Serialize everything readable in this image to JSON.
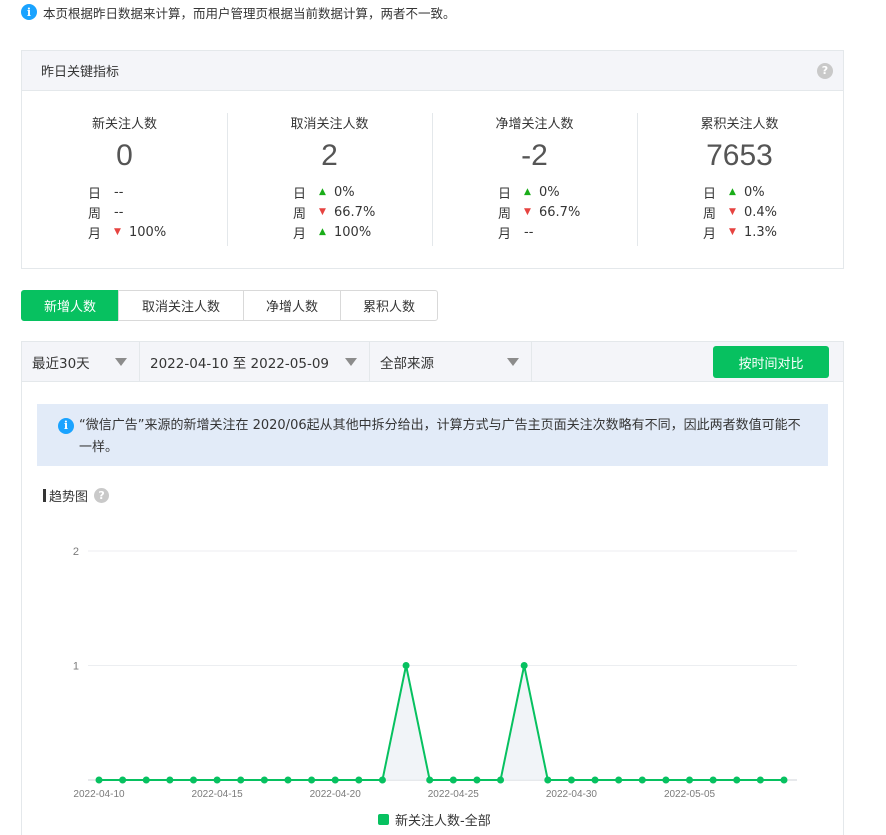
{
  "notice": "本页根据昨日数据来计算，而用户管理页根据当前数据计算，两者不一致。",
  "card": {
    "title": "昨日关键指标",
    "metrics": [
      {
        "title": "新关注人数",
        "value": "0",
        "rows": [
          {
            "label": "日",
            "dir": "",
            "text": "--"
          },
          {
            "label": "周",
            "dir": "",
            "text": "--"
          },
          {
            "label": "月",
            "dir": "down",
            "text": "100%"
          }
        ]
      },
      {
        "title": "取消关注人数",
        "value": "2",
        "rows": [
          {
            "label": "日",
            "dir": "up",
            "text": "0%"
          },
          {
            "label": "周",
            "dir": "down",
            "text": "66.7%"
          },
          {
            "label": "月",
            "dir": "up",
            "text": "100%"
          }
        ]
      },
      {
        "title": "净增关注人数",
        "value": "-2",
        "rows": [
          {
            "label": "日",
            "dir": "up",
            "text": "0%"
          },
          {
            "label": "周",
            "dir": "down",
            "text": "66.7%"
          },
          {
            "label": "月",
            "dir": "",
            "text": "--"
          }
        ]
      },
      {
        "title": "累积关注人数",
        "value": "7653",
        "rows": [
          {
            "label": "日",
            "dir": "up",
            "text": "0%"
          },
          {
            "label": "周",
            "dir": "down",
            "text": "0.4%"
          },
          {
            "label": "月",
            "dir": "down",
            "text": "1.3%"
          }
        ]
      }
    ]
  },
  "tabs": [
    {
      "label": "新增人数",
      "active": true
    },
    {
      "label": "取消关注人数",
      "active": false
    },
    {
      "label": "净增人数",
      "active": false
    },
    {
      "label": "累积人数",
      "active": false
    }
  ],
  "filters": {
    "range": "最近30天",
    "dates": "2022-04-10 至 2022-05-09",
    "source": "全部来源",
    "compare_button": "按时间对比"
  },
  "tip": "“微信广告”来源的新增关注在 2020/06起从其他中拆分给出，计算方式与广告主页面关注次数略有不同，因此两者数值可能不一样。",
  "trend_title": "趋势图",
  "colors": {
    "accent": "#07c160",
    "up": "#1aad19",
    "down": "#e64340",
    "info": "#1aa3ff"
  },
  "chart_data": {
    "type": "line",
    "x": [
      "2022-04-10",
      "2022-04-11",
      "2022-04-12",
      "2022-04-13",
      "2022-04-14",
      "2022-04-15",
      "2022-04-16",
      "2022-04-17",
      "2022-04-18",
      "2022-04-19",
      "2022-04-20",
      "2022-04-21",
      "2022-04-22",
      "2022-04-23",
      "2022-04-24",
      "2022-04-25",
      "2022-04-26",
      "2022-04-27",
      "2022-04-28",
      "2022-04-29",
      "2022-04-30",
      "2022-05-01",
      "2022-05-02",
      "2022-05-03",
      "2022-05-04",
      "2022-05-05",
      "2022-05-06",
      "2022-05-07",
      "2022-05-08",
      "2022-05-09"
    ],
    "x_tick_labels": [
      "2022-04-10",
      "2022-04-15",
      "2022-04-20",
      "2022-04-25",
      "2022-04-30",
      "2022-05-05"
    ],
    "series": [
      {
        "name": "新关注人数-全部",
        "values": [
          0,
          0,
          0,
          0,
          0,
          0,
          0,
          0,
          0,
          0,
          0,
          0,
          0,
          1,
          0,
          0,
          0,
          0,
          1,
          0,
          0,
          0,
          0,
          0,
          0,
          0,
          0,
          0,
          0,
          0
        ]
      }
    ],
    "yticks": [
      1,
      2
    ],
    "ylim": [
      0,
      2
    ],
    "grid": true,
    "legend": "bottom-center"
  }
}
